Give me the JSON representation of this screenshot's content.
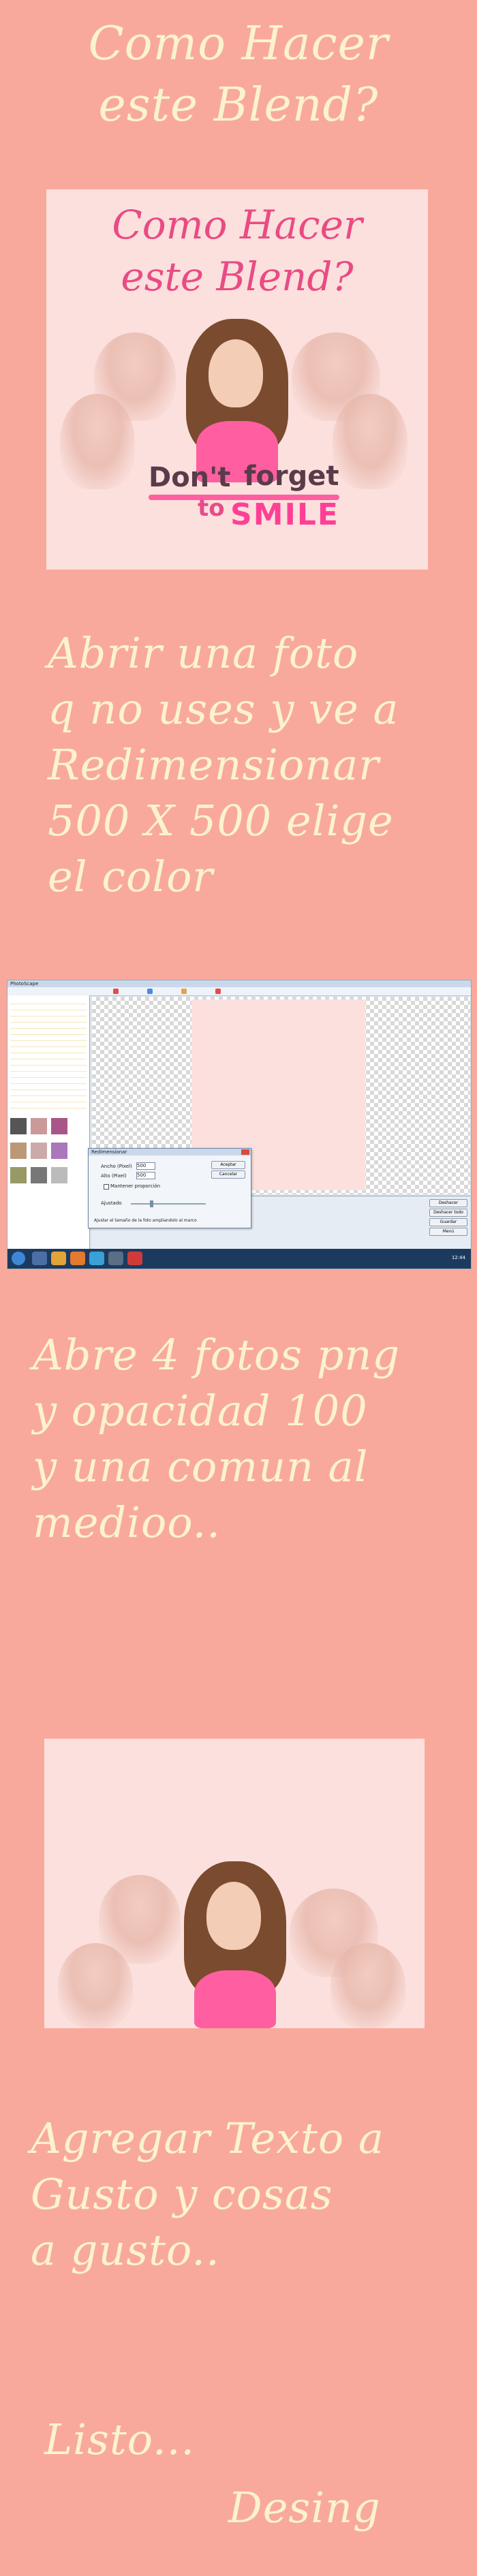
{
  "title": [
    "Como Hacer",
    "este Blend?"
  ],
  "preview": {
    "title": [
      "Como Hacer",
      "este Blend?"
    ],
    "logo": [
      "Don't",
      "forget",
      "to",
      "SMILE"
    ]
  },
  "steps": {
    "step1": [
      "Abrir una foto",
      "q no uses y ve a",
      "Redimensionar",
      "500 X 500 elige",
      "el color"
    ],
    "step2": [
      "Abre 4 fotos png",
      "y opacidad 100",
      "y una comun al",
      "medioo.."
    ],
    "step3": [
      "Agregar Texto a",
      "Gusto y cosas",
      "a gusto.."
    ]
  },
  "closing": {
    "listo": "Listo...",
    "desing": "Desing"
  },
  "screenshot": {
    "window_title": "PhotoScape",
    "dialog": {
      "title": "Redimensionar",
      "width_label": "Ancho (Pixel)",
      "width_value": "500",
      "height_label": "Alto (Pixel)",
      "height_value": "500",
      "ok": "Aceptar",
      "cancel": "Cancelar",
      "keep_ratio": "Mantener proporción",
      "quality_label": "Ajustado",
      "note": "Ajustar el tamaño de la foto ampliandolo al marco"
    },
    "right_buttons": [
      "Deshacer",
      "Deshacer todo",
      "Guardar",
      "Menú"
    ],
    "clock": "12:44"
  },
  "colors": {
    "background": "#f9a99c",
    "cream_text": "#fbf3cf",
    "pink_title": "#ea4b84",
    "panel": "#fbe0dd"
  }
}
